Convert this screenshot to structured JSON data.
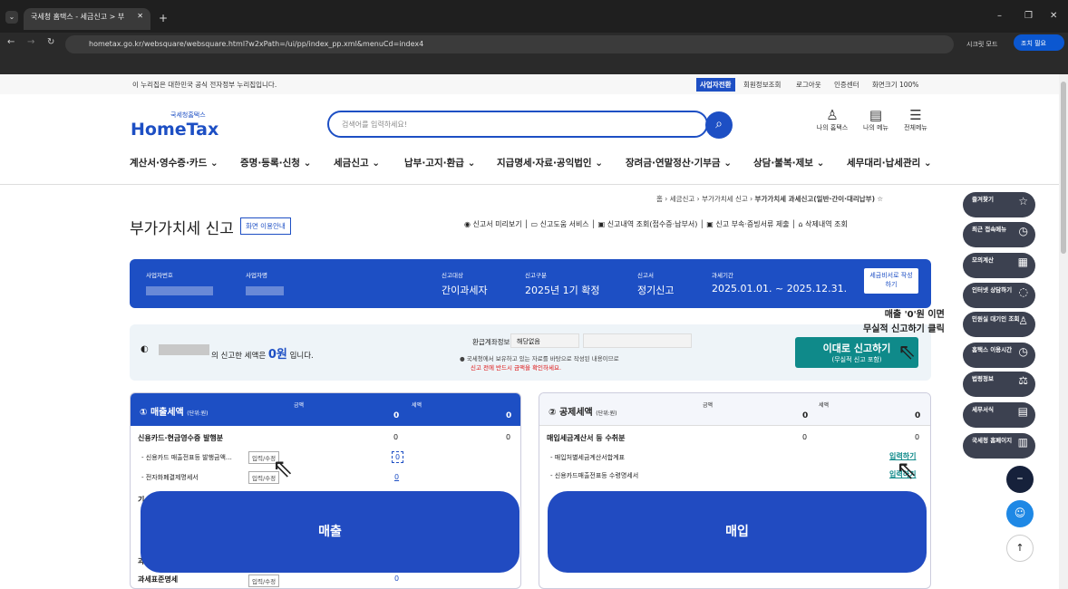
{
  "browser": {
    "tab_title": "국세청 홈택스 - 세금신고 > 부",
    "url": "hometax.go.kr/websquare/websquare.html?w2xPath=/ui/pp/index_pp.xml&menuCd=index4",
    "secret_mode": "시크릿 모드",
    "menu_btn": "조치 필요"
  },
  "gov_banner": {
    "text": "이 누리집은 대한민국 공식 전자정부 누리집입니다.",
    "links": [
      "사업자전환",
      "회원정보조회",
      "로그아웃",
      "인증센터",
      "화면크기 100%"
    ]
  },
  "logo": {
    "small": "국세청홈택스",
    "big": "HomeTax"
  },
  "search": {
    "placeholder": "검색어를 입력하세요!"
  },
  "top_icons": [
    "나의 홈택스",
    "나의 메뉴",
    "전체메뉴"
  ],
  "gnb": [
    "계산서·영수증·카드",
    "증명·등록·신청",
    "세금신고",
    "납부·고지·환급",
    "지급명세·자료·공익법인",
    "장려금·연말정산·기부금",
    "상담·불복·제보",
    "세무대리·납세관리"
  ],
  "breadcrumb": [
    "홈",
    "세금신고",
    "부가가치세 신고",
    "부가가치세 과세신고(일반·간이·대리납부)"
  ],
  "page": {
    "title": "부가가치세 신고",
    "guide_btn": "화면 이용안내",
    "links": [
      "신고서 미리보기",
      "신고도움 서비스",
      "신고내역 조회(접수증·납부서)",
      "신고 부속·증빙서류 제출",
      "삭제내역 조회"
    ]
  },
  "info_bar": {
    "biz_no_label": "사업자번호",
    "biz_name_label": "사업자명",
    "target_label": "신고대상",
    "target": "간이과세자",
    "type_label": "신고구분",
    "type": "2025년 1기 확정",
    "kind_label": "신고서",
    "kind": "정기신고",
    "period_label": "과세기간",
    "period": "2025.01.01. ~ 2025.12.31.",
    "btn": "세금비서로 작성하기"
  },
  "summary": {
    "text_suffix": "의 신고한 세액은",
    "amount": "0원",
    "text_end": "입니다.",
    "refund_label": "환급계좌정보",
    "refund_value": "해당없음",
    "notice1": "국세청에서 보유하고 있는 자료를 바탕으로 작성된 내용이므로",
    "notice2": "신고 전에 반드시 금액을 확인하세요.",
    "submit_btn": "이대로 신고하기",
    "submit_sub": "(무실적 신고 포함)",
    "annot1": "매출 '0'원 이면",
    "annot2": "무실적 신고하기 클릭"
  },
  "sales": {
    "title": "매출세액",
    "unit": "(단위:원)",
    "col1": "금액",
    "col2": "세액",
    "v1": "0",
    "v2": "0",
    "row1": "신용카드·현금영수증 발행분",
    "row1_v": "0",
    "row1_t": "0",
    "sub1": "- 신용카드 매출전표등 발행금액…",
    "sub1_v": "0",
    "sub2": "- 전자화폐결제명세서",
    "sub2_v": "0",
    "btn": "입력/수정",
    "row_last": "과세표준명세",
    "row_last_v": "0",
    "frag1": "기",
    "frag2": "과",
    "overlay": "매출"
  },
  "purchase": {
    "title": "공제세액",
    "unit": "(단위:원)",
    "col1": "금액",
    "col2": "세액",
    "v1": "0",
    "v2": "0",
    "row1": "매입세금계산서 등 수취분",
    "row1_v": "0",
    "row1_t": "0",
    "sub1": "- 매입처별세금계산서합계표",
    "sub2": "- 신용카드매출전표등 수령명세서",
    "link": "입력하기",
    "overlay": "매입"
  },
  "side": [
    "즐겨찾기",
    "최근 접속메뉴",
    "모의계산",
    "인터넷 상담하기",
    "민원실 대기인 조회",
    "홈택스 이용시간",
    "법령정보",
    "세무서식",
    "국세청 홈페이지"
  ],
  "colors": {
    "primary": "#1d4fc4",
    "teal": "#0f8a8a",
    "overlay": "#214bc1"
  }
}
